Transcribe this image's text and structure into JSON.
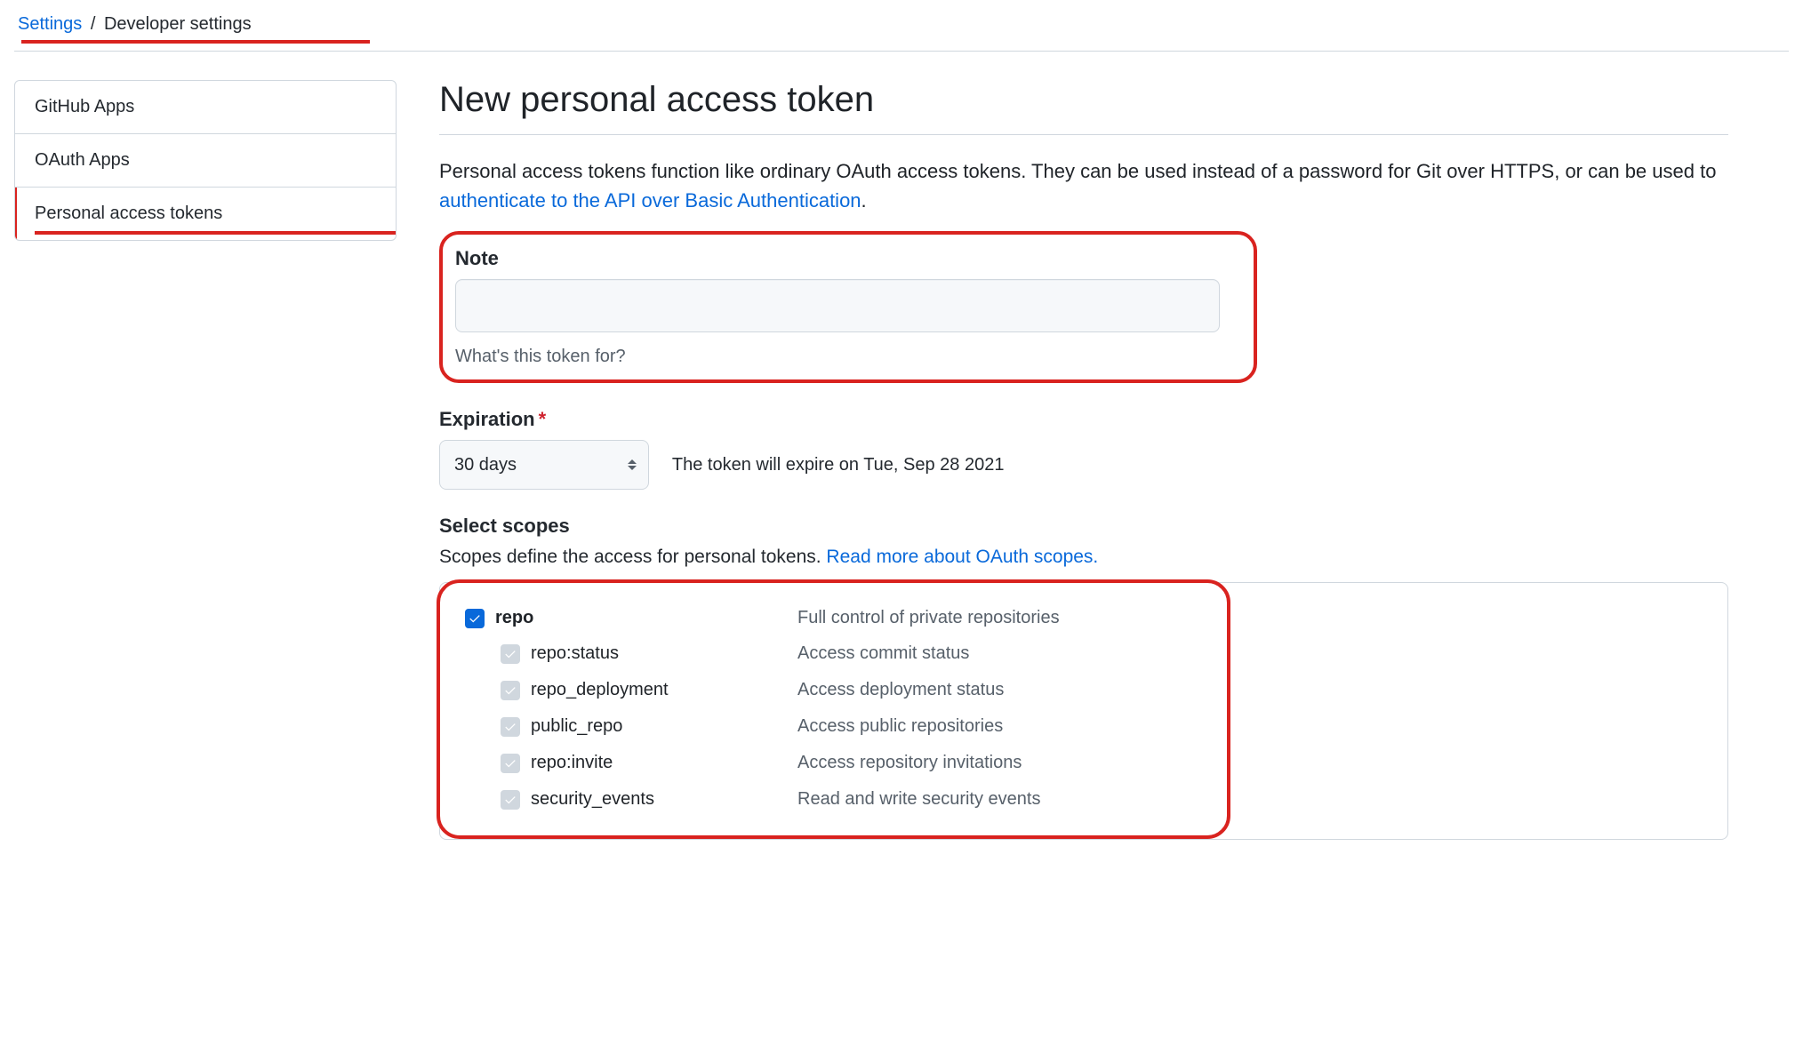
{
  "breadcrumb": {
    "root": "Settings",
    "sep": "/",
    "current": "Developer settings"
  },
  "sidebar": {
    "items": [
      {
        "label": "GitHub Apps",
        "selected": false
      },
      {
        "label": "OAuth Apps",
        "selected": false
      },
      {
        "label": "Personal access tokens",
        "selected": true
      }
    ]
  },
  "page": {
    "title": "New personal access token",
    "intro_before_link": "Personal access tokens function like ordinary OAuth access tokens. They can be used instead of a password for Git over HTTPS, or can be used to ",
    "intro_link": "authenticate to the API over Basic Authentication",
    "intro_after_link": "."
  },
  "note": {
    "label": "Note",
    "value": "",
    "help": "What's this token for?"
  },
  "expiration": {
    "label": "Expiration",
    "selected": "30 days",
    "message": "The token will expire on Tue, Sep 28 2021"
  },
  "scopes": {
    "heading": "Select scopes",
    "intro": "Scopes define the access for personal tokens. ",
    "link": "Read more about OAuth scopes.",
    "groups": [
      {
        "name": "repo",
        "desc": "Full control of private repositories",
        "checked": true,
        "children": [
          {
            "name": "repo:status",
            "desc": "Access commit status"
          },
          {
            "name": "repo_deployment",
            "desc": "Access deployment status"
          },
          {
            "name": "public_repo",
            "desc": "Access public repositories"
          },
          {
            "name": "repo:invite",
            "desc": "Access repository invitations"
          },
          {
            "name": "security_events",
            "desc": "Read and write security events"
          }
        ]
      }
    ]
  }
}
